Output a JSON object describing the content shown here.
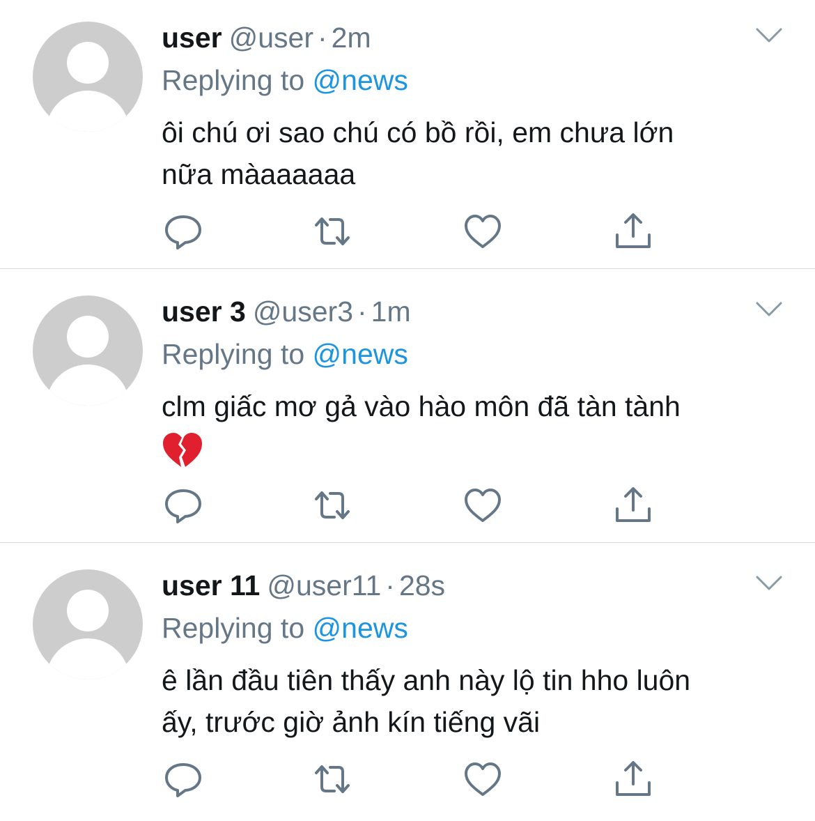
{
  "tweets": [
    {
      "name": "user",
      "handle": "@user",
      "time": "2m",
      "replying_label": "Replying to",
      "reply_to": "@news",
      "text_lines": [
        "ôi chú ơi sao chú có bồ rồi, em chưa lớn",
        "nữa màaaaaaa"
      ]
    },
    {
      "name": "user 3",
      "handle": "@user3",
      "time": "1m",
      "replying_label": "Replying to",
      "reply_to": "@news",
      "text_lines": [
        "clm giấc mơ gả vào hào môn đã tàn tành",
        ""
      ],
      "emoji": "broken-heart"
    },
    {
      "name": "user 11",
      "handle": "@user11",
      "time": "28s",
      "replying_label": "Replying to",
      "reply_to": "@news",
      "text_lines": [
        "ê lần đầu tiên thấy anh này lộ tin hho luôn",
        "ấy, trước giờ ảnh kín tiếng vãi"
      ]
    }
  ],
  "separator": "·",
  "icons": {
    "reply": "reply-icon",
    "retweet": "retweet-icon",
    "like": "like-icon",
    "share": "share-icon",
    "menu": "chevron-down-icon"
  },
  "colors": {
    "text": "#14171a",
    "secondary": "#657786",
    "mention": "#1b95e0",
    "avatar": "#cdcdcd",
    "divider": "#d6dbdf"
  }
}
